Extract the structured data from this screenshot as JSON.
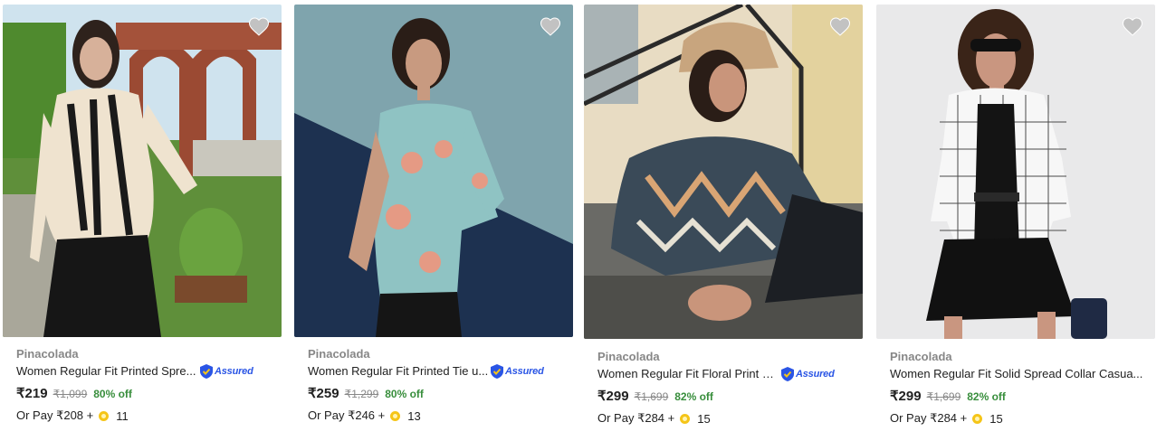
{
  "products": [
    {
      "brand": "Pinacolada",
      "title": "Women Regular Fit Printed Spre...",
      "assured": true,
      "price": "₹219",
      "mrp": "₹1,099",
      "discount": "80% off",
      "pay_text": "Or Pay ₹208 +",
      "coins": "11",
      "wishlist_icon": "heart-icon"
    },
    {
      "brand": "Pinacolada",
      "title": "Women Regular Fit Printed Tie u...",
      "assured": true,
      "price": "₹259",
      "mrp": "₹1,299",
      "discount": "80% off",
      "pay_text": "Or Pay ₹246 +",
      "coins": "13",
      "wishlist_icon": "heart-icon"
    },
    {
      "brand": "Pinacolada",
      "title": "Women Regular Fit Floral Print S...",
      "assured": true,
      "price": "₹299",
      "mrp": "₹1,699",
      "discount": "82% off",
      "pay_text": "Or Pay ₹284 +",
      "coins": "15",
      "wishlist_icon": "heart-icon"
    },
    {
      "brand": "Pinacolada",
      "title": "Women Regular Fit Solid Spread Collar Casua...",
      "assured": false,
      "price": "₹299",
      "mrp": "₹1,699",
      "discount": "82% off",
      "pay_text": "Or Pay ₹284 +",
      "coins": "15",
      "wishlist_icon": "heart-icon"
    }
  ],
  "assured_label": "Assured",
  "colors": {
    "discount_green": "#388e3c",
    "brand_grey": "#878787",
    "assured_blue": "#2a55e5",
    "coin_gold": "#f5c518"
  }
}
